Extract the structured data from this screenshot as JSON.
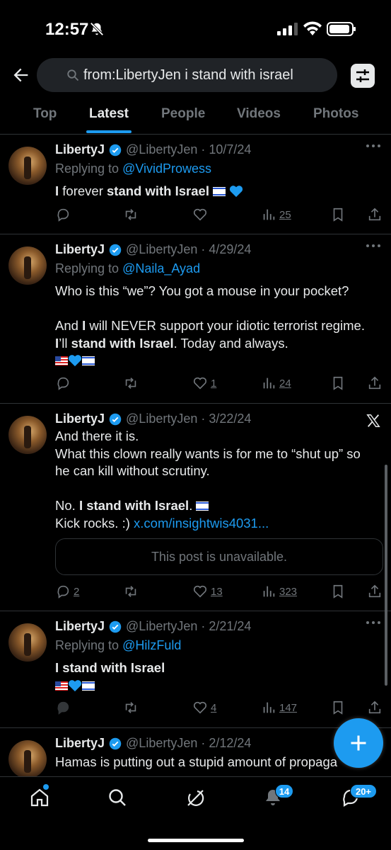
{
  "status_bar": {
    "time": "12:57"
  },
  "search": {
    "query": "from:LibertyJen i stand with israel"
  },
  "tabs": [
    "Top",
    "Latest",
    "People",
    "Videos",
    "Photos"
  ],
  "tweets": [
    {
      "name": "LibertyJ",
      "handle": "@LibertyJen",
      "date": "· 10/7/24",
      "replying_prefix": "Replying to",
      "replying_to": "@VividProwess",
      "text_a": "I",
      "text_b": " forever ",
      "text_c": "stand with Israel",
      "replies": "",
      "retweets": "",
      "likes": "",
      "views": "25"
    },
    {
      "name": "LibertyJ",
      "handle": "@LibertyJen",
      "date": "· 4/29/24",
      "replying_prefix": "Replying to",
      "replying_to": "@Naila_Ayad",
      "line1": "Who is this “we”?  You got a mouse in your pocket?",
      "line3a": "And ",
      "line3b": "I",
      "line3c": " will NEVER support your idiotic terrorist regime.",
      "line4a": "I",
      "line4b": "’ll ",
      "line4c": "stand with Israel",
      "line4d": ".  Today and always.",
      "replies": "",
      "retweets": "",
      "likes": "1",
      "views": "24"
    },
    {
      "name": "LibertyJ",
      "handle": "@LibertyJen",
      "date": "· 3/22/24",
      "line1": "And there it is.",
      "line2": "What this clown really wants is for me to “shut up” so",
      "line3": "he can kill without scrutiny.",
      "line5a": "No.  ",
      "line5b": "I stand with Israel",
      "line5c": ".",
      "line6a": "Kick rocks. :) ",
      "line6b": "x.com/insightwis4031...",
      "quote_text": "This post is unavailable.",
      "replies": "2",
      "retweets": "",
      "likes": "13",
      "views": "323"
    },
    {
      "name": "LibertyJ",
      "handle": "@LibertyJen",
      "date": "· 2/21/24",
      "replying_prefix": "Replying to",
      "replying_to": "@HilzFuld",
      "line1": "I stand with Israel",
      "replies": "",
      "retweets": "",
      "likes": "4",
      "views": "147"
    },
    {
      "name": "LibertyJ",
      "handle": "@LibertyJen",
      "date": "· 2/12/24",
      "line1": "Hamas is putting out a stupid amount of propaga"
    }
  ],
  "bottom_nav": {
    "notifications_badge": "14",
    "messages_badge": "20+"
  },
  "colors": {
    "accent": "#1d9bf0",
    "background": "#000000",
    "muted": "#71767b"
  }
}
